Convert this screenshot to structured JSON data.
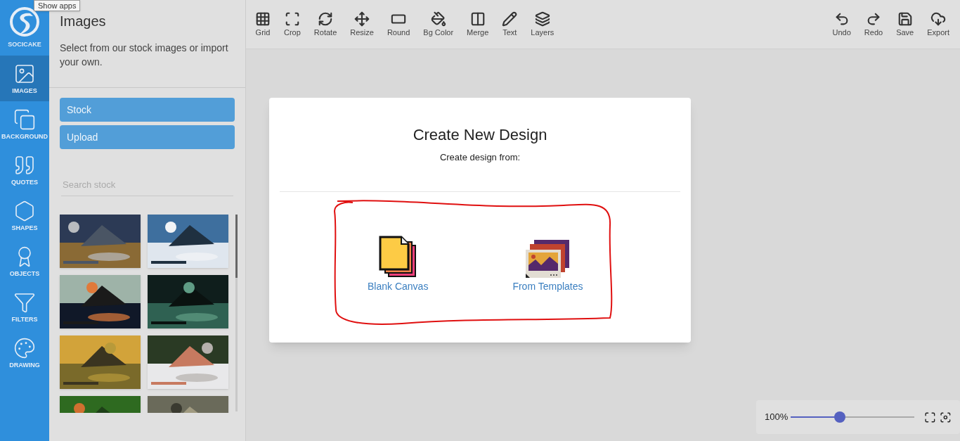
{
  "tooltip": "Show apps",
  "brand": "SOCICAKE",
  "rail": [
    {
      "kind": "images",
      "label": "IMAGES",
      "selected": true
    },
    {
      "kind": "background",
      "label": "BACKGROUND",
      "selected": false
    },
    {
      "kind": "quotes",
      "label": "QUOTES",
      "selected": false
    },
    {
      "kind": "shapes",
      "label": "SHAPES",
      "selected": false
    },
    {
      "kind": "objects",
      "label": "OBJECTS",
      "selected": false
    },
    {
      "kind": "filters",
      "label": "FILTERS",
      "selected": false
    },
    {
      "kind": "drawing",
      "label": "DRAWING",
      "selected": false
    }
  ],
  "panel": {
    "title": "Images",
    "description": "Select from our stock images or import your own.",
    "buttons": [
      "Stock",
      "Upload"
    ],
    "search": {
      "placeholder": "Search stock"
    }
  },
  "toolbar": {
    "left": [
      {
        "kind": "grid",
        "label": "Grid"
      },
      {
        "kind": "crop",
        "label": "Crop"
      },
      {
        "kind": "rotate",
        "label": "Rotate"
      },
      {
        "kind": "resize",
        "label": "Resize"
      },
      {
        "kind": "round",
        "label": "Round"
      },
      {
        "kind": "bgcolor",
        "label": "Bg Color"
      },
      {
        "kind": "merge",
        "label": "Merge"
      },
      {
        "kind": "text",
        "label": "Text"
      },
      {
        "kind": "layers",
        "label": "Layers"
      }
    ],
    "right": [
      {
        "kind": "undo",
        "label": "Undo"
      },
      {
        "kind": "redo",
        "label": "Redo"
      },
      {
        "kind": "save",
        "label": "Save"
      },
      {
        "kind": "export",
        "label": "Export"
      }
    ]
  },
  "dialog": {
    "title": "Create New Design",
    "subtitle": "Create design from:",
    "options": [
      {
        "kind": "blank",
        "label": "Blank Canvas"
      },
      {
        "kind": "templates",
        "label": "From Templates"
      }
    ]
  },
  "zoom": {
    "reading": "100%",
    "level": 0.4
  }
}
